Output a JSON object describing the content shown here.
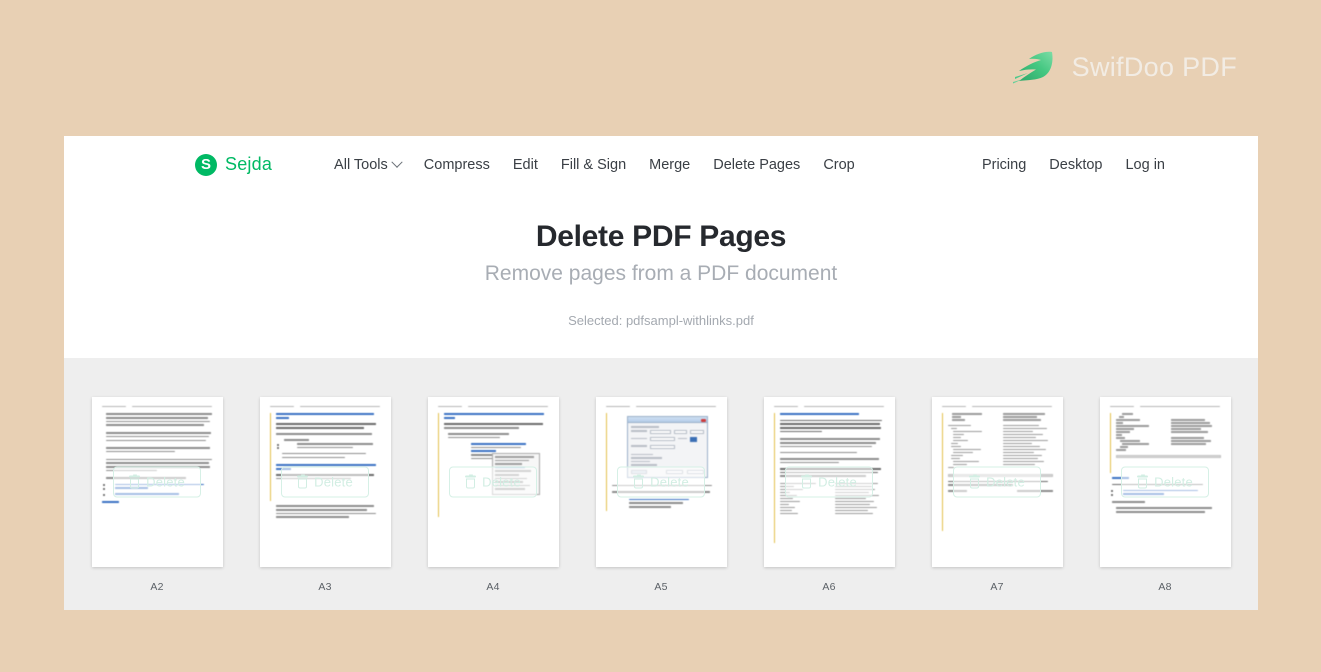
{
  "branding": {
    "product_name": "SwifDoo PDF",
    "logo_icon": "swift-bird-icon",
    "logo_color": "#3bbd78",
    "text_color": "#f2ece4"
  },
  "background_color": "#e8d0b4",
  "nav": {
    "brand": {
      "mark_letter": "S",
      "name": "Sejda",
      "color": "#00b964"
    },
    "left_items": [
      {
        "label": "All Tools",
        "has_chevron": true
      },
      {
        "label": "Compress",
        "has_chevron": false
      },
      {
        "label": "Edit",
        "has_chevron": false
      },
      {
        "label": "Fill & Sign",
        "has_chevron": false
      },
      {
        "label": "Merge",
        "has_chevron": false
      },
      {
        "label": "Delete Pages",
        "has_chevron": false
      },
      {
        "label": "Crop",
        "has_chevron": false
      }
    ],
    "right_items": [
      {
        "label": "Pricing"
      },
      {
        "label": "Desktop"
      },
      {
        "label": "Log in"
      }
    ]
  },
  "hero": {
    "title": "Delete PDF Pages",
    "subtitle": "Remove pages from a PDF document",
    "selected_file": "Selected: pdfsampl-withlinks.pdf"
  },
  "pages_panel": {
    "delete_label": "Delete",
    "delete_icon": "trash-icon",
    "panel_color": "#eeeeee",
    "pages": [
      {
        "label": "A2",
        "layout": "text-paragraphs-links"
      },
      {
        "label": "A3",
        "layout": "headings-bullets"
      },
      {
        "label": "A4",
        "layout": "heading-context-menu-screenshot"
      },
      {
        "label": "A5",
        "layout": "dialog-screenshot"
      },
      {
        "label": "A6",
        "layout": "dense-paragraphs-code"
      },
      {
        "label": "A7",
        "layout": "code-two-column"
      },
      {
        "label": "A8",
        "layout": "code-and-links"
      }
    ]
  }
}
